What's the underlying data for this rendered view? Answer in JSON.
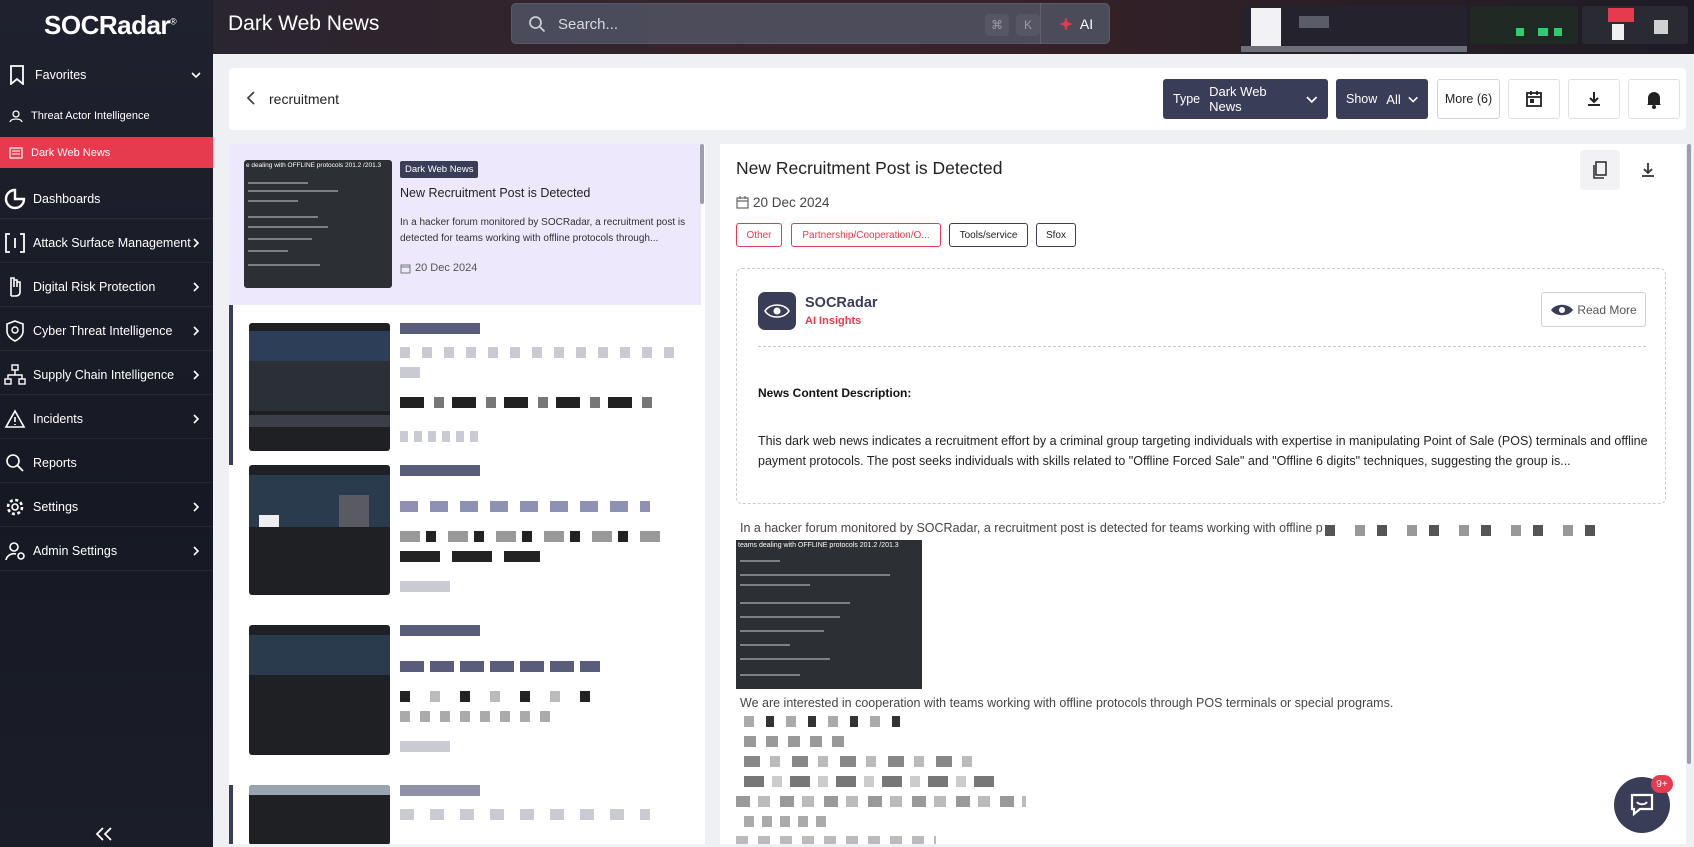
{
  "brand": {
    "name": "SOCRadar",
    "registered": "®"
  },
  "header": {
    "title": "Dark Web News"
  },
  "search": {
    "placeholder": "Search...",
    "shortcut_cmd": "⌘",
    "shortcut_key": "K",
    "ai_label": "AI"
  },
  "sidebar": {
    "favorites": {
      "label": "Favorites",
      "items": [
        {
          "label": "Threat Actor Intelligence",
          "icon": "user-secret-icon"
        },
        {
          "label": "Dark Web News",
          "icon": "news-icon",
          "active": true
        }
      ]
    },
    "items": [
      {
        "label": "Dashboards",
        "icon": "dashboard-icon"
      },
      {
        "label": "Attack Surface Management",
        "icon": "bracket-icon"
      },
      {
        "label": "Digital Risk Protection",
        "icon": "hand-icon"
      },
      {
        "label": "Cyber Threat Intelligence",
        "icon": "shield-icon"
      },
      {
        "label": "Supply Chain Intelligence",
        "icon": "network-icon"
      },
      {
        "label": "Incidents",
        "icon": "alert-icon"
      },
      {
        "label": "Reports",
        "icon": "report-icon"
      },
      {
        "label": "Settings",
        "icon": "gear-icon"
      },
      {
        "label": "Admin Settings",
        "icon": "admin-icon"
      }
    ]
  },
  "filter": {
    "query": "recruitment",
    "type_key": "Type",
    "type_value": "Dark Web News",
    "show_key": "Show",
    "show_value": "All",
    "more_label": "More (6)"
  },
  "list": {
    "selected": {
      "badge": "Dark Web News",
      "title": "New Recruitment Post is Detected",
      "description": "In a hacker forum monitored by SOCRadar, a recruitment post is detected for teams working with offline protocols through...",
      "date": "20 Dec 2024",
      "thumb_title": "e dealing with OFFLINE protocols 201.2 /201.3"
    }
  },
  "detail": {
    "title": "New Recruitment Post is Detected",
    "date": "20 Dec 2024",
    "tags": [
      "Other",
      "Partnership/Cooperation/O...",
      "Tools/service",
      "Sfox"
    ],
    "ai": {
      "name": "SOCRadar",
      "subtitle": "AI Insights",
      "read_more": "Read More",
      "heading": "News Content Description:",
      "paragraph": "This dark web news indicates a recruitment effort by a criminal group targeting individuals with expertise in manipulating Point of Sale (POS) terminals and offline payment protocols. The post seeks individuals with skills related to \"Offline Forced Sale\" and \"Offline 6 digits\" techniques, suggesting the group is..."
    },
    "body_line1": "In a hacker forum monitored by SOCRadar, a recruitment post is detected for teams working with offline p",
    "image_title": "teams dealing with OFFLINE protocols 201.2 /201.3",
    "body_line2": "We are interested in cooperation with teams working with offline protocols through POS terminals or special programs."
  },
  "chat": {
    "badge": "9+"
  },
  "colors": {
    "accent": "#e63b4f",
    "navy": "#3a3d58",
    "selected_bg": "#ede8fb"
  }
}
